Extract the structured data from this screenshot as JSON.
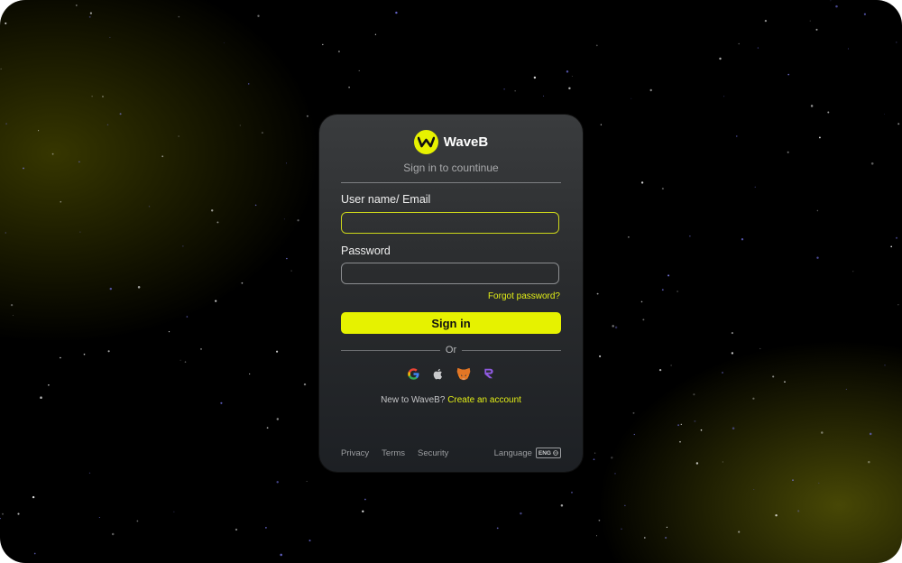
{
  "brand": {
    "name": "WaveB",
    "logo_icon": "wave-w-icon",
    "accent": "#e6f200"
  },
  "subtitle": "Sign in to countinue",
  "form": {
    "username_label": "User name/ Email",
    "username_value": "",
    "password_label": "Password",
    "password_value": "",
    "forgot_label": "Forgot password?",
    "signin_label": "Sign in"
  },
  "or_label": "Or",
  "social": [
    {
      "name": "google-icon"
    },
    {
      "name": "apple-icon"
    },
    {
      "name": "metamask-icon"
    },
    {
      "name": "r-brand-icon"
    }
  ],
  "signup": {
    "prompt": "New to WaveB?",
    "link": "Create an account"
  },
  "footer": {
    "privacy": "Privacy",
    "terms": "Terms",
    "security": "Security",
    "language_label": "Language",
    "language_value": "ENG"
  }
}
